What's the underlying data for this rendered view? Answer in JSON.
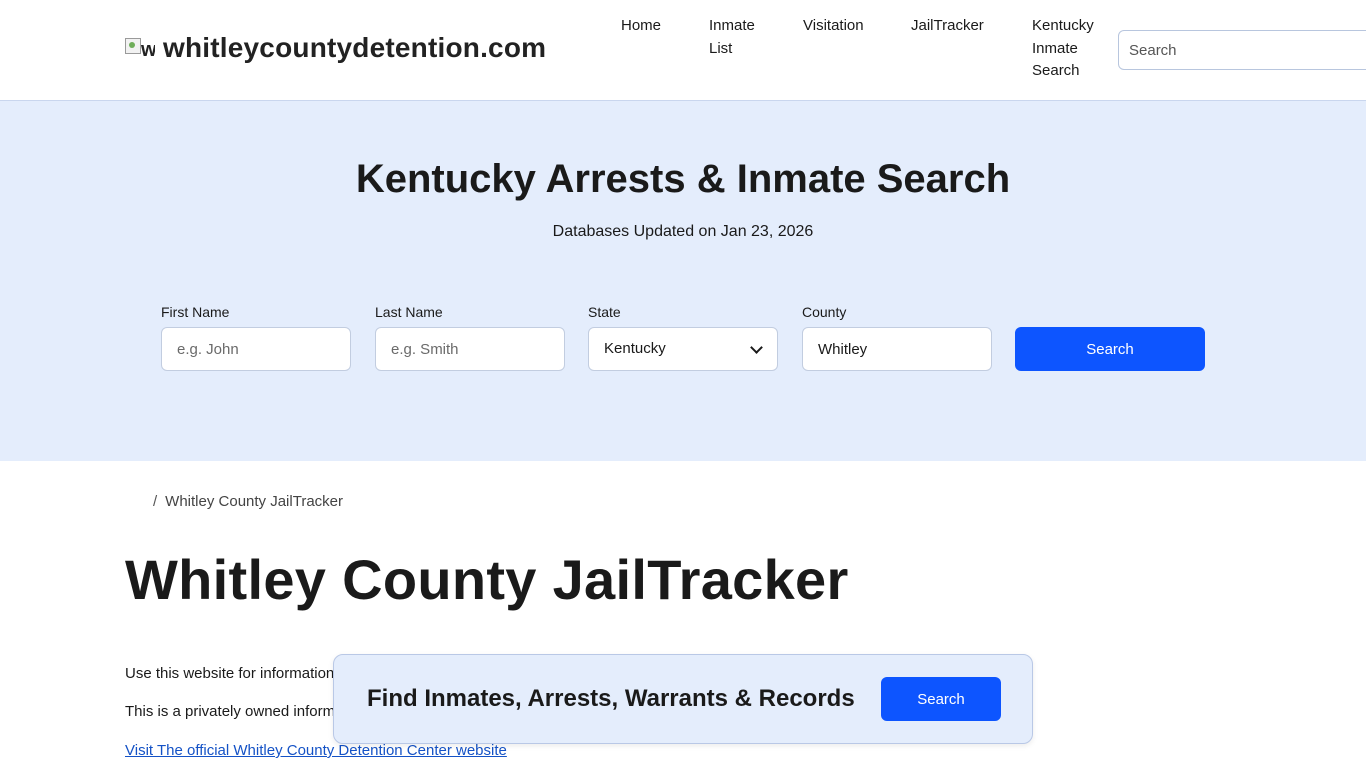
{
  "header": {
    "logo_alt_fragment": "w",
    "logo_text": "whitleycountydetention.com",
    "nav": {
      "home": "Home",
      "inmate_list": "Inmate List",
      "visitation": "Visitation",
      "jailtracker": "JailTracker",
      "ky_search": "Kentucky Inmate Search"
    },
    "search_placeholder": "Search"
  },
  "hero": {
    "title": "Kentucky Arrests & Inmate Search",
    "updated": "Databases Updated on Jan 23, 2026",
    "form": {
      "first_name_label": "First Name",
      "first_name_placeholder": "e.g. John",
      "last_name_label": "Last Name",
      "last_name_placeholder": "e.g. Smith",
      "state_label": "State",
      "state_value": "Kentucky",
      "county_label": "County",
      "county_value": "Whitley",
      "search_label": "Search"
    }
  },
  "content": {
    "breadcrumb_sep": "/",
    "breadcrumb_current": "Whitley County JailTracker",
    "title": "Whitley County JailTracker",
    "para1": "Use this website for information",
    "para2": "This is a privately owned inform",
    "official_link": "Visit The official Whitley County Detention Center website"
  },
  "banner": {
    "text": "Find Inmates, Arrests, Warrants & Records",
    "button": "Search"
  },
  "colors": {
    "accent": "#0d55ff",
    "hero_bg": "#e4edfc",
    "link": "#1452c6"
  },
  "icons": {
    "logo": "broken-image-icon",
    "select": "chevron-down-icon"
  }
}
